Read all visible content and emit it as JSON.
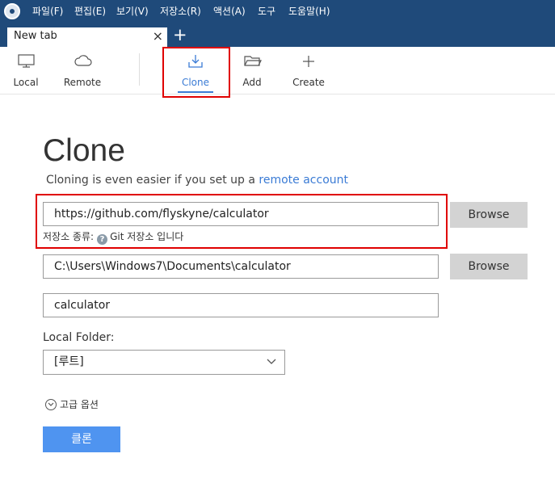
{
  "menu": {
    "items": [
      "파일(F)",
      "편집(E)",
      "보기(V)",
      "저장소(R)",
      "액션(A)",
      "도구",
      "도움말(H)"
    ]
  },
  "tabs": {
    "active_title": "New tab",
    "close_glyph": "×",
    "new_tab_glyph": "+"
  },
  "toolbar": {
    "local": "Local",
    "remote": "Remote",
    "clone": "Clone",
    "add": "Add",
    "create": "Create"
  },
  "main": {
    "title": "Clone",
    "subtitle_text": "Cloning is even easier if you set up a ",
    "subtitle_link": "remote account",
    "source_url": "https://github.com/flyskyne/calculator",
    "repo_type_label": "저장소 종류:",
    "repo_type_value": "Git 저장소 입니다",
    "help_glyph": "?",
    "destination_path": "C:\\Users\\Windows7\\Documents\\calculator",
    "name": "calculator",
    "browse_label": "Browse",
    "local_folder_label": "Local Folder:",
    "local_folder_value": "[루트]",
    "advanced_options": "고급 옵션",
    "clone_button": "클론"
  },
  "colors": {
    "titlebar": "#1f4a7a",
    "accent": "#3a7bd5",
    "clone_button": "#4f94f0",
    "highlight_box": "#e00000"
  },
  "icons": {
    "app_logo": "app-logo-icon",
    "local": "monitor-icon",
    "remote": "cloud-icon",
    "clone": "download-icon",
    "add": "folder-icon",
    "create": "plus-icon",
    "help": "help-icon",
    "advanced": "chevron-down-circle-icon",
    "select": "chevron-down-icon"
  }
}
